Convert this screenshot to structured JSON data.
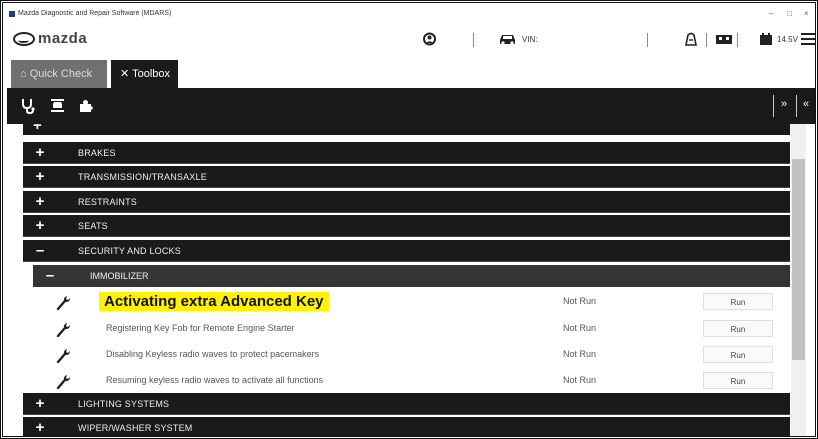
{
  "window": {
    "title": "Mazda Diagnostic and Repair Software (MDARS)",
    "controls": [
      "–",
      "□",
      "×"
    ]
  },
  "brand": {
    "logo_text": "mazda",
    "vin_label": "VIN:",
    "voltage": "14.5V"
  },
  "tabs": [
    {
      "label": "Quick Check",
      "icon": "home-icon"
    },
    {
      "label": "Toolbox",
      "icon": "tools-icon"
    }
  ],
  "toolbar": {
    "icons": [
      "stethoscope-icon",
      "car-lift-icon",
      "puzzle-icon"
    ],
    "collapse_all": "»",
    "expand_all": "«"
  },
  "tree": {
    "categories": [
      {
        "label": "BRAKES",
        "toggle": "+"
      },
      {
        "label": "TRANSMISSION/TRANSAXLE",
        "toggle": "+"
      },
      {
        "label": "RESTRAINTS",
        "toggle": "+"
      },
      {
        "label": "SEATS",
        "toggle": "+"
      },
      {
        "label": "SECURITY AND LOCKS",
        "toggle": "–"
      },
      {
        "label": "LIGHTING SYSTEMS",
        "toggle": "+"
      },
      {
        "label": "WIPER/WASHER SYSTEM",
        "toggle": "+"
      }
    ],
    "subcategory": {
      "label": "IMMOBILIZER",
      "toggle": "–"
    },
    "items": [
      {
        "name": "Activating extra Advanced Key",
        "status": "Not Run",
        "button": "Run",
        "highlighted": true
      },
      {
        "name": "Registering Key Fob for Remote Engine Starter",
        "status": "Not Run",
        "button": "Run"
      },
      {
        "name": "Disabling Keyless radio waves to protect pacemakers",
        "status": "Not Run",
        "button": "Run"
      },
      {
        "name": "Resuming keyless radio waves to activate all functions",
        "status": "Not Run",
        "button": "Run"
      }
    ]
  },
  "colors": {
    "highlight": "#fff200",
    "bar_dark": "#1a1a1a",
    "sub_dark": "#353535"
  }
}
